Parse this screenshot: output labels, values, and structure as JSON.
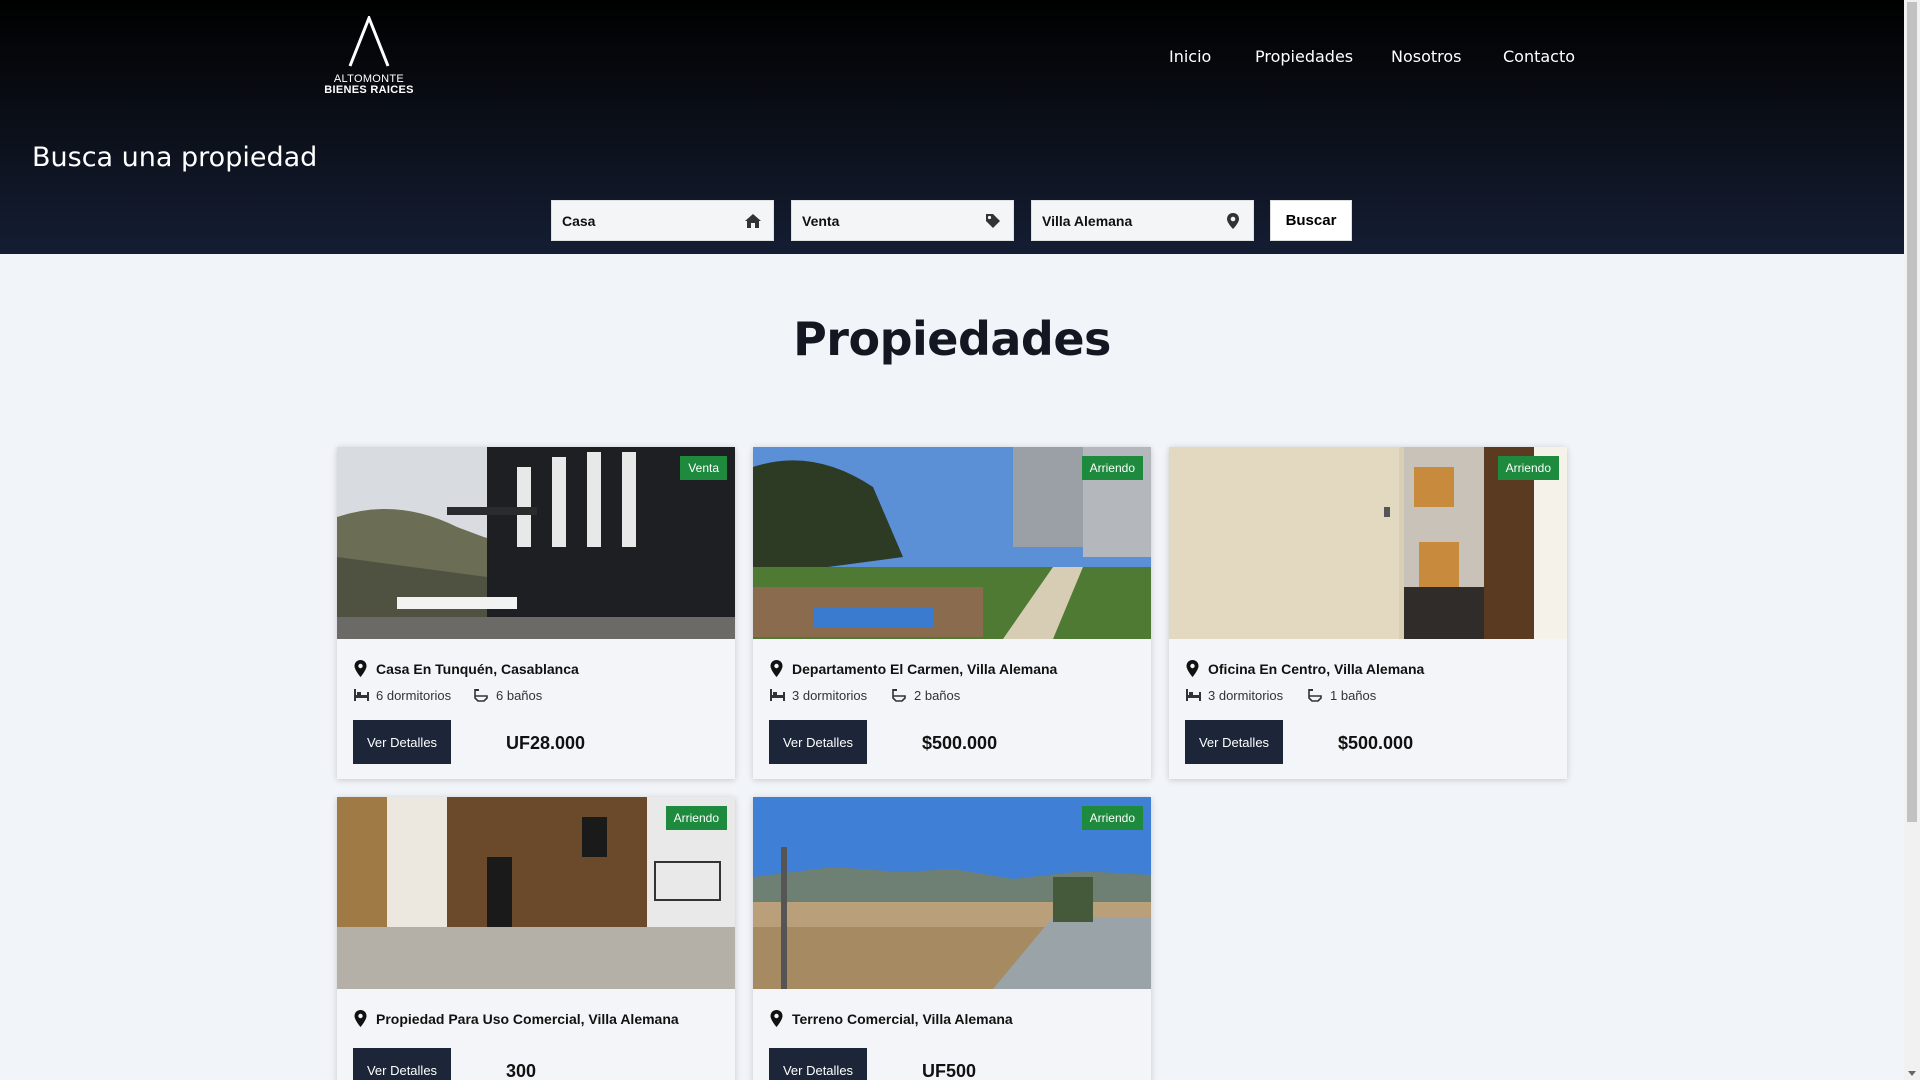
{
  "brand": {
    "line1": "ALTOMONTE",
    "line2": "BIENES RAICES"
  },
  "nav": {
    "items": [
      {
        "label": "Inicio"
      },
      {
        "label": "Propiedades"
      },
      {
        "label": "Nosotros"
      },
      {
        "label": "Contacto"
      }
    ]
  },
  "hero": {
    "title": "Busca una propiedad"
  },
  "search": {
    "type_value": "Casa",
    "operation_value": "Venta",
    "location_value": "Villa Alemana",
    "button_label": "Buscar",
    "icons": [
      "home-icon",
      "tag-icon",
      "map-pin-icon"
    ]
  },
  "section": {
    "title": "Propiedades"
  },
  "colors": {
    "badge": "#1d8a3e",
    "button": "#1c2638",
    "header_bottom": "#141d33"
  },
  "properties": [
    {
      "badge": "Venta",
      "title": "Casa En Tunquén, Casablanca",
      "beds": "6 dormitorios",
      "baths": "6 baños",
      "button_label": "Ver Detalles",
      "price": "UF28.000"
    },
    {
      "badge": "Arriendo",
      "title": "Departamento El Carmen, Villa Alemana",
      "beds": "3 dormitorios",
      "baths": "2 baños",
      "button_label": "Ver Detalles",
      "price": "$500.000"
    },
    {
      "badge": "Arriendo",
      "title": "Oficina En Centro, Villa Alemana",
      "beds": "3 dormitorios",
      "baths": "1 baños",
      "button_label": "Ver Detalles",
      "price": "$500.000"
    },
    {
      "badge": "Arriendo",
      "title": "Propiedad Para Uso Comercial, Villa Alemana",
      "button_label": "Ver Detalles",
      "price": "300"
    },
    {
      "badge": "Arriendo",
      "title": "Terreno Comercial, Villa Alemana",
      "button_label": "Ver Detalles",
      "price": "UF500"
    }
  ]
}
